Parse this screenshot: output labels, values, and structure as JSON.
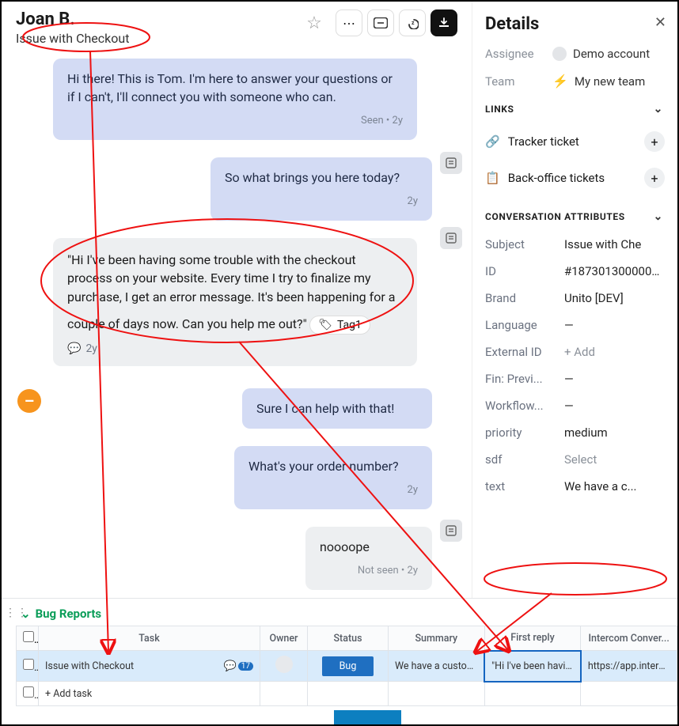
{
  "header": {
    "contact_name": "Joan B.",
    "subject": "Issue with Checkout"
  },
  "messages": {
    "m1_text": "Hi there! This is Tom. I'm here to answer your questions or if I can't, I'll connect you with someone who can.",
    "m1_meta": "Seen • 2y",
    "m2_text": "So what brings you here today?",
    "m2_meta": "2y",
    "m3_text": "\"Hi I've been having some trouble with the checkout process on your website. Every time I try to finalize my purchase, I get an error message. It's been happening for a couple of days now. Can you help me out?\"",
    "m3_tag": "Tag1",
    "m3_footer": "2y",
    "m4_text": "Sure I can help with that!",
    "m5_text": "What's your order number?",
    "m5_meta": "2y",
    "m6_text": "noooope",
    "m6_meta": "Not seen • 2y"
  },
  "details": {
    "title": "Details",
    "assignee_label": "Assignee",
    "assignee_value": "Demo account",
    "team_label": "Team",
    "team_value": "My new team",
    "links_label": "LINKS",
    "tracker_label": "Tracker ticket",
    "backoffice_label": "Back-office tickets",
    "attrs_label": "CONVERSATION ATTRIBUTES",
    "subject_k": "Subject",
    "subject_v": "Issue with Che",
    "id_k": "ID",
    "id_v": "#18730130000000",
    "brand_k": "Brand",
    "brand_v": "Unito [DEV]",
    "language_k": "Language",
    "language_v": "—",
    "ext_k": "External ID",
    "ext_v": "+ Add",
    "fin_k": "Fin: Previ...",
    "fin_v": "—",
    "wf_k": "Workflow...",
    "wf_v": "—",
    "prio_k": "priority",
    "prio_v": "medium",
    "sdf_k": "sdf",
    "sdf_v": "Select",
    "text_k": "text",
    "text_v": "We have a c..."
  },
  "table": {
    "group_title": "Bug Reports",
    "headers": {
      "task": "Task",
      "owner": "Owner",
      "status": "Status",
      "summary": "Summary",
      "first_reply": "First reply",
      "intercom": "Intercom Conver..."
    },
    "row1": {
      "task": "Issue with Checkout",
      "chat_count": "17",
      "status": "Bug",
      "summary": "We have a custome...",
      "first_reply": "\"Hi I've been having...",
      "intercom": "https://app.interco..."
    },
    "add_task": "+ Add task"
  }
}
